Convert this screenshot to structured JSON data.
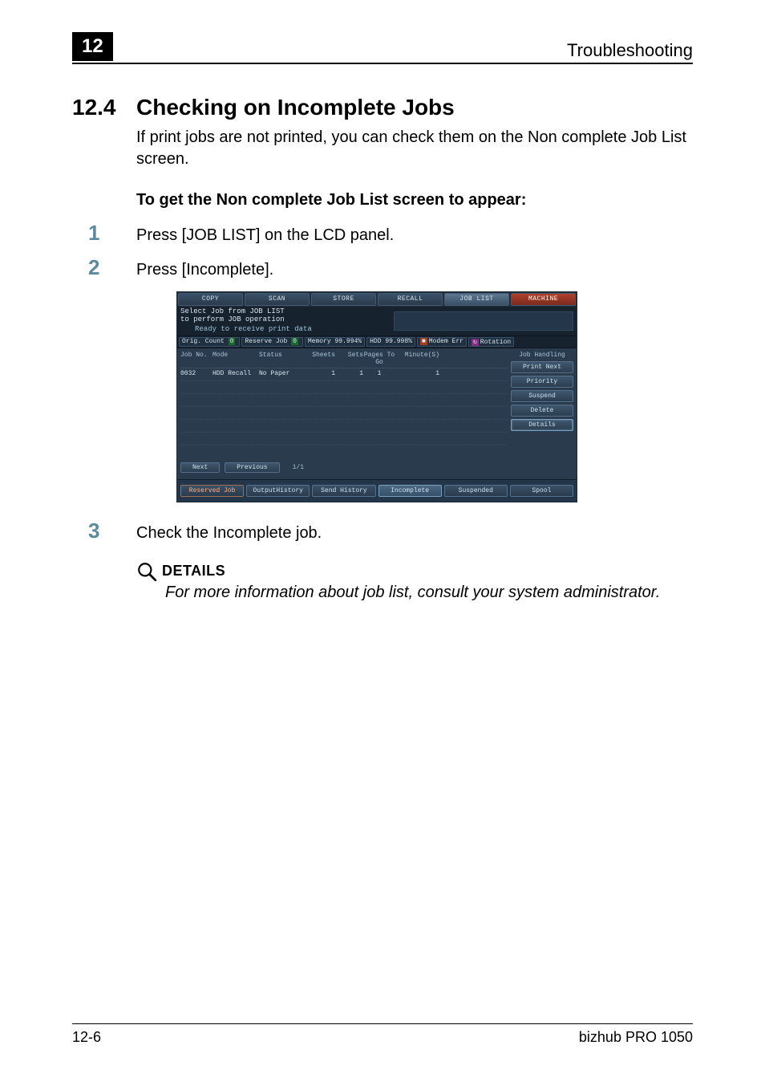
{
  "header": {
    "chapter_number": "12",
    "chapter_title": "Troubleshooting"
  },
  "section": {
    "number": "12.4",
    "title": "Checking on Incomplete Jobs",
    "intro": "If print jobs are not printed, you can check them on the Non complete Job List screen.",
    "subhead": "To get the Non complete Job List screen to appear:"
  },
  "steps": [
    {
      "n": "1",
      "text": "Press [JOB LIST] on the LCD panel."
    },
    {
      "n": "2",
      "text": "Press [Incomplete]."
    },
    {
      "n": "3",
      "text": "Check the Incomplete job."
    }
  ],
  "lcd": {
    "top_tabs": [
      "COPY",
      "SCAN",
      "STORE",
      "RECALL",
      "JOB LIST",
      "MACHINE"
    ],
    "msg_line1": "Select Job from JOB LIST",
    "msg_line2": "to perform JOB operation",
    "msg_sub": "Ready to receive print data",
    "status": {
      "orig_count_label": "Orig. Count",
      "orig_count_badge": "0",
      "reserve_label": "Reserve Job",
      "reserve_badge": "0",
      "memory_label": "Memory",
      "memory_value": "99.994%",
      "hdd_label": "HDD",
      "hdd_value": "99.998%",
      "modem_label": "Modem Err",
      "rotation_label": "Rotation"
    },
    "columns": [
      "Job No.",
      "Mode",
      "Status",
      "Sheets",
      "Sets",
      "Pages To Go",
      "Minute(S)"
    ],
    "row": {
      "job_no": "0032",
      "mode": "HDD Recall",
      "status": "No Paper",
      "sheets": "1",
      "sets": "1",
      "pages": "1",
      "minutes": "1"
    },
    "nav": {
      "next": "Next",
      "prev": "Previous",
      "page": "1/1"
    },
    "side_head": "Job Handling",
    "side_buttons": [
      "Print Next",
      "Priority",
      "Suspend",
      "Delete",
      "Details"
    ],
    "bottom_tabs": [
      "Reserved Job",
      "OutputHistory",
      "Send History",
      "Incomplete",
      "Suspended",
      "Spool"
    ]
  },
  "details": {
    "label": "DETAILS",
    "text": "For more information about job list, consult your system administrator."
  },
  "footer": {
    "left": "12-6",
    "right": "bizhub PRO 1050"
  }
}
